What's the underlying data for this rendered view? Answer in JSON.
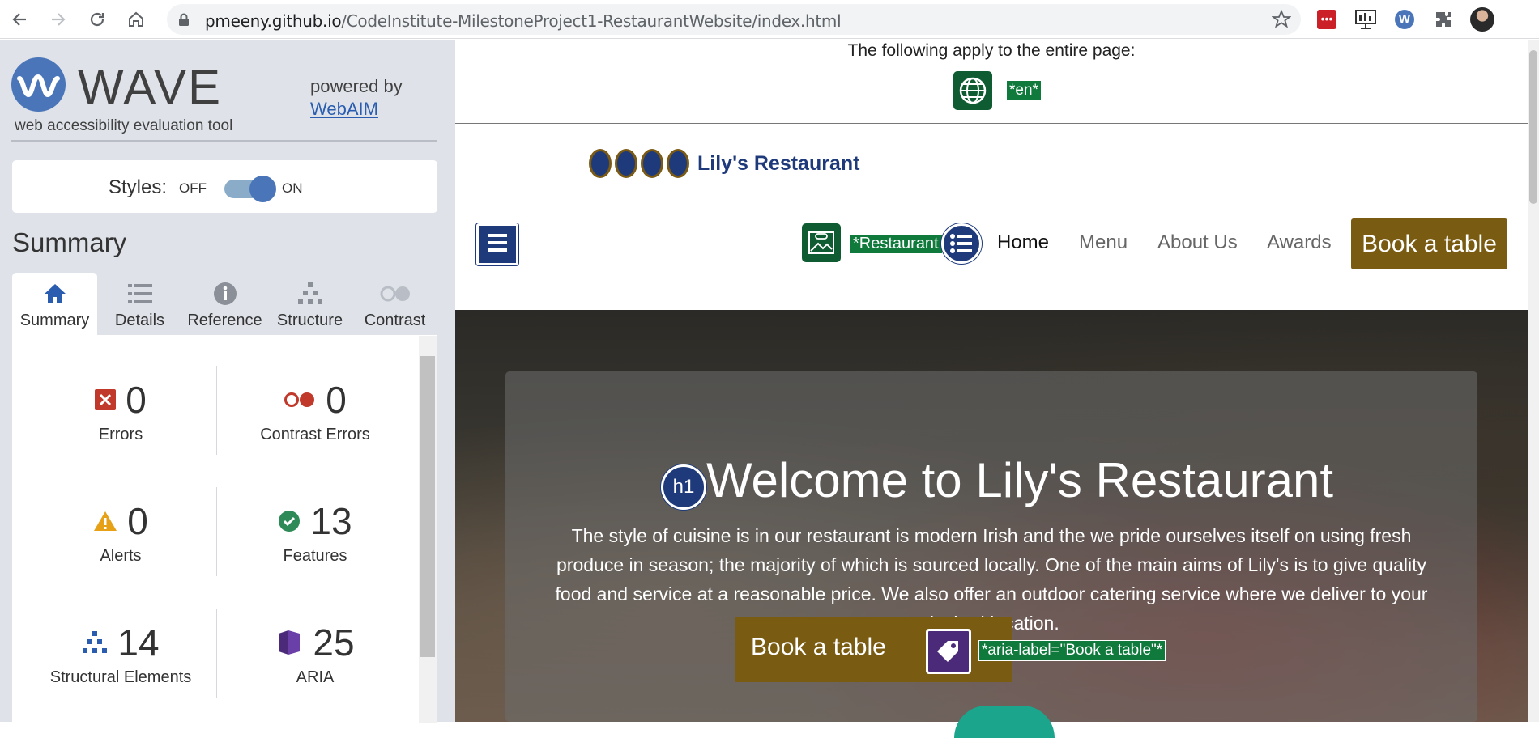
{
  "browser": {
    "url_host": "pmeeny.github.io",
    "url_path": "/CodeInstitute-MilestoneProject1-RestaurantWebsite/index.html"
  },
  "wave": {
    "logo_text": "WAVE",
    "subtitle": "web accessibility evaluation tool",
    "powered_by": "powered by",
    "webaim_link": "WebAIM",
    "styles_label": "Styles:",
    "toggle_off": "OFF",
    "toggle_on": "ON",
    "summary_heading": "Summary",
    "tabs": [
      {
        "label": "Summary",
        "icon": "home-icon"
      },
      {
        "label": "Details",
        "icon": "list-icon"
      },
      {
        "label": "Reference",
        "icon": "info-icon"
      },
      {
        "label": "Structure",
        "icon": "hierarchy-icon"
      },
      {
        "label": "Contrast",
        "icon": "contrast-icon"
      }
    ],
    "stats": [
      {
        "count": "0",
        "label": "Errors",
        "icon": "error-icon",
        "color": "#c0392b"
      },
      {
        "count": "0",
        "label": "Contrast Errors",
        "icon": "contrast-error-icon",
        "color": "#c0392b"
      },
      {
        "count": "0",
        "label": "Alerts",
        "icon": "alert-icon",
        "color": "#e6a117"
      },
      {
        "count": "13",
        "label": "Features",
        "icon": "feature-check-icon",
        "color": "#2e8b57"
      },
      {
        "count": "14",
        "label": "Structural Elements",
        "icon": "structure-icon",
        "color": "#2a5db0"
      },
      {
        "count": "25",
        "label": "ARIA",
        "icon": "aria-icon",
        "color": "#4b2a7a"
      }
    ]
  },
  "page": {
    "entire_note": "The following apply to the entire page:",
    "lang_tag": "*en*",
    "brand_name": "Lily's Restaurant",
    "alt_tag": "*Restaurant",
    "nav": [
      "Home",
      "Menu",
      "About Us",
      "Awards"
    ],
    "book_top": "Book a table",
    "hero_title": "Welcome to Lily's Restaurant",
    "h1_label": "h1",
    "hero_text": "The style of cuisine is in our restaurant is modern Irish and the we pride ourselves itself on using fresh produce in season; the majority of which is sourced locally. One of the main aims of Lily's is to give quality food and service at a reasonable price. We also offer an outdoor catering service where we deliver to your desired location.",
    "book_hero": "Book a table",
    "aria_tag": "*aria-label=\"Book a table\"*"
  }
}
